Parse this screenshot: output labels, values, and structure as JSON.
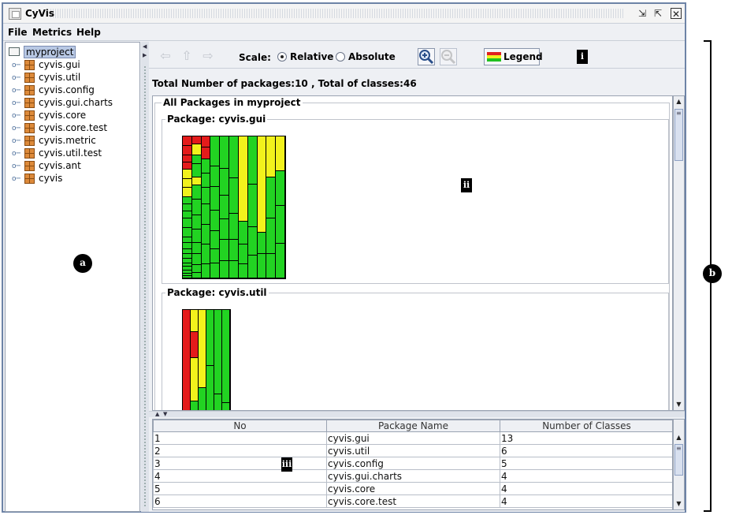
{
  "window": {
    "title": "CyVis"
  },
  "menu": [
    "File",
    "Metrics",
    "Help"
  ],
  "tree": {
    "root": "myproject",
    "items": [
      "cyvis.gui",
      "cyvis.util",
      "cyvis.config",
      "cyvis.gui.charts",
      "cyvis.core",
      "cyvis.core.test",
      "cyvis.metric",
      "cyvis.util.test",
      "cyvis.ant",
      "cyvis"
    ]
  },
  "toolbar": {
    "scale_label": "Scale:",
    "relative_label": "Relative",
    "absolute_label": "Absolute",
    "selected_scale": "Relative",
    "legend_label": "Legend"
  },
  "summary": {
    "totals": "Total Number of packages:10 , Total of classes:46"
  },
  "view": {
    "all_title": "All Packages in myproject",
    "packages": [
      {
        "title": "Package: cyvis.gui"
      },
      {
        "title": "Package: cyvis.util"
      }
    ]
  },
  "colors": {
    "red": "#e41b1b",
    "yellow": "#f2f21c",
    "green": "#22d322"
  },
  "table": {
    "headers": [
      "No",
      "Package Name",
      "Number of Classes"
    ],
    "rows": [
      [
        "1",
        "cyvis.gui",
        "13"
      ],
      [
        "2",
        "cyvis.util",
        "6"
      ],
      [
        "3",
        "cyvis.config",
        "5"
      ],
      [
        "4",
        "cyvis.gui.charts",
        "4"
      ],
      [
        "5",
        "cyvis.core",
        "4"
      ],
      [
        "6",
        "cyvis.core.test",
        "4"
      ]
    ]
  },
  "annotations": {
    "a": "a",
    "b": "b",
    "i": "i",
    "ii": "ii",
    "iii": "iii"
  }
}
